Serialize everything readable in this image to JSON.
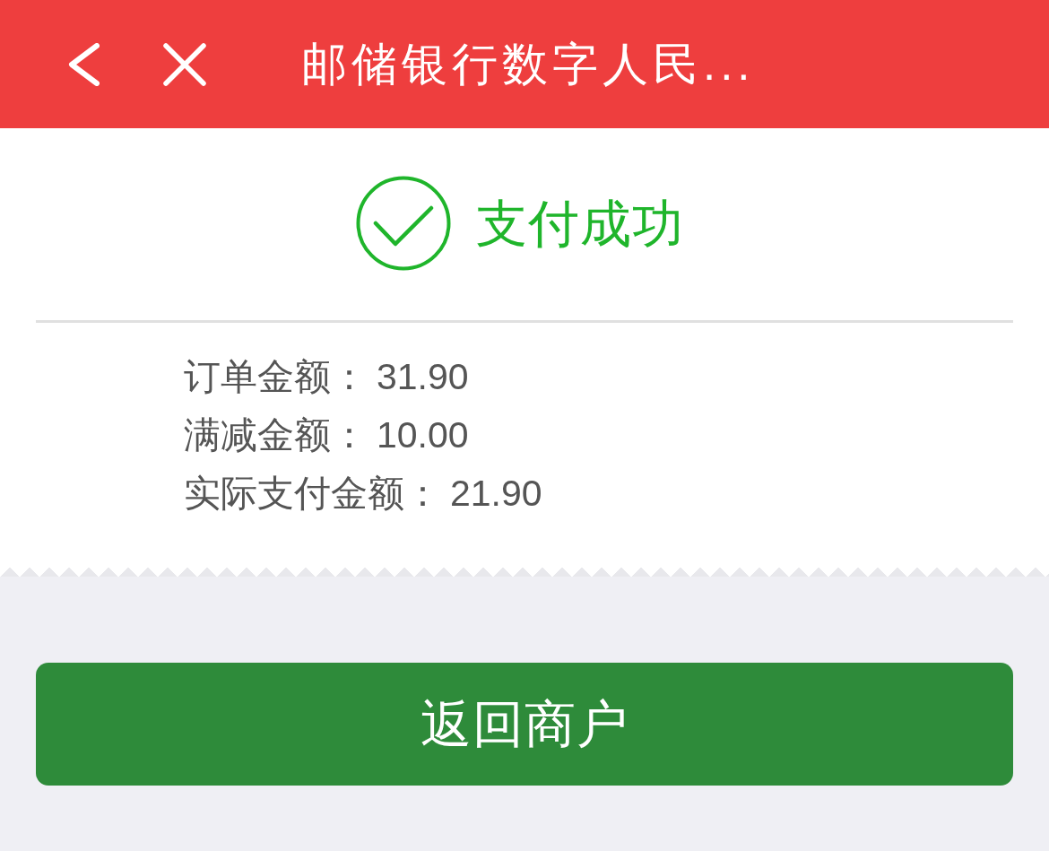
{
  "header": {
    "title": "邮储银行数字人民..."
  },
  "result": {
    "title": "支付成功"
  },
  "details": [
    {
      "label": "订单金额：",
      "value": "31.90"
    },
    {
      "label": "满减金额：",
      "value": "10.00"
    },
    {
      "label": "实际支付金额：",
      "value": "21.90"
    }
  ],
  "button": {
    "label": "返回商户"
  }
}
